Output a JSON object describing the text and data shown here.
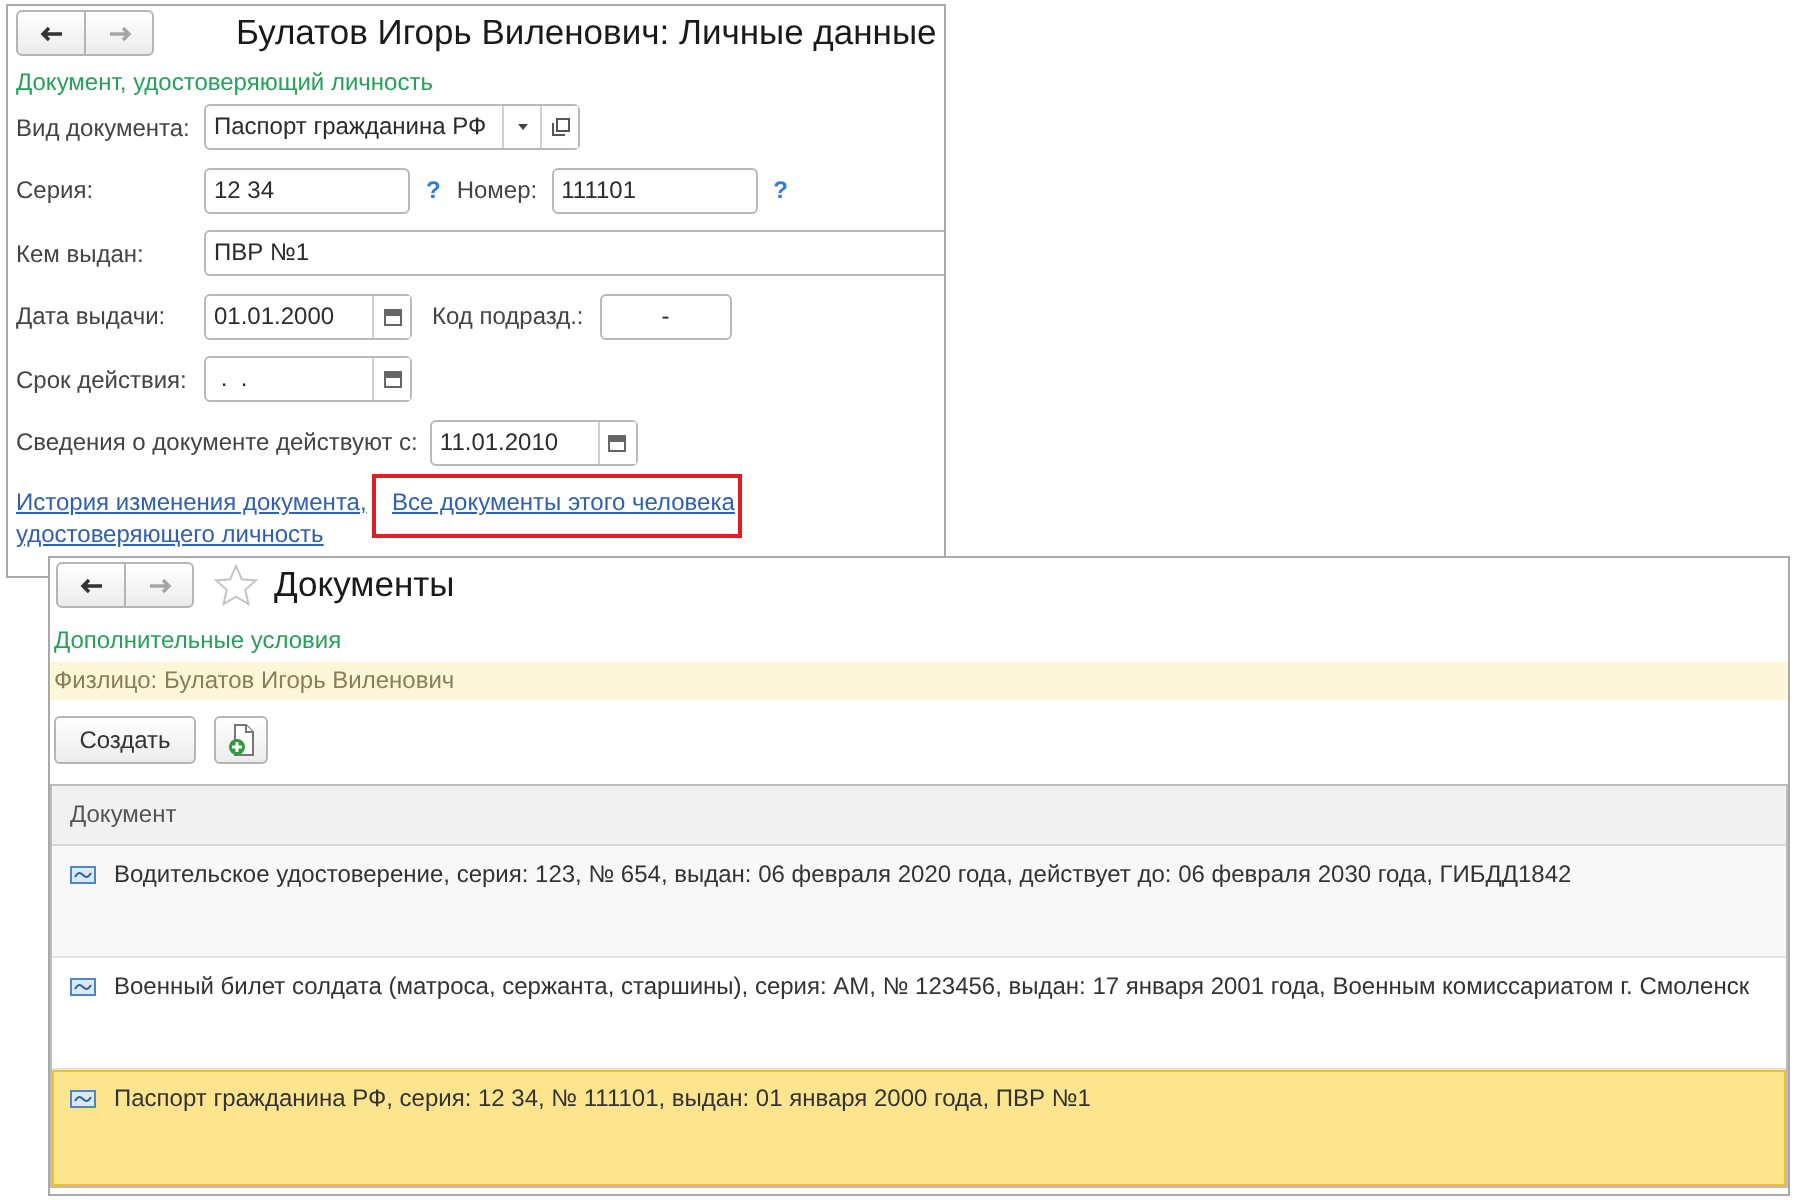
{
  "personal_data_window": {
    "title": "Булатов Игорь Виленович: Личные данные",
    "nav": [
      {
        "kind": "back",
        "disabled": false
      },
      {
        "kind": "forward",
        "disabled": true
      }
    ],
    "section_title": "Документ, удостоверяющий личность",
    "document_type": {
      "label": "Вид документа:",
      "value": "Паспорт гражданина РФ"
    },
    "series": {
      "label": "Серия:",
      "value": "12 34",
      "help": "?"
    },
    "number": {
      "label": "Номер:",
      "value": "111101",
      "help": "?"
    },
    "issued_by": {
      "label": "Кем выдан:",
      "value": "ПВР №1"
    },
    "issue_date": {
      "label": "Дата выдачи:",
      "value": "01.01.2000"
    },
    "department_code": {
      "label": "Код подразд.:",
      "value": "-"
    },
    "valid_until": {
      "label": "Срок действия:",
      "value": " .  ."
    },
    "effective_from": {
      "label": "Сведения о документе действуют с:",
      "value": "11.01.2010"
    },
    "links": [
      {
        "text": "История изменения документа, удостоверяющего личность",
        "highlighted": false
      },
      {
        "text": "Все документы этого человека",
        "highlighted": true
      }
    ]
  },
  "documents_window": {
    "title": "Документы",
    "favorite": false,
    "nav": [
      {
        "kind": "back",
        "disabled": false
      },
      {
        "kind": "forward",
        "disabled": true
      }
    ],
    "section_title": "Дополнительные условия",
    "filter": "Физлицо: Булатов Игорь Виленович",
    "create_button": "Создать",
    "table": {
      "columns": [
        "Документ"
      ],
      "rows": [
        {
          "text": "Водительское удостоверение, серия: 123, № 654, выдан: 06 февраля 2020 года, действует до: 06 февраля 2030 года, ГИБДД1842",
          "selected": false
        },
        {
          "text": "Военный билет солдата (матроса, сержанта, старшины), серия: АМ, № 123456, выдан: 17 января 2001 года, Военным комиссариатом г. Смоленск",
          "selected": false
        },
        {
          "text": "Паспорт гражданина РФ, серия: 12 34, № 111101, выдан: 01 января 2000 года, ПВР №1",
          "selected": true
        }
      ]
    }
  }
}
